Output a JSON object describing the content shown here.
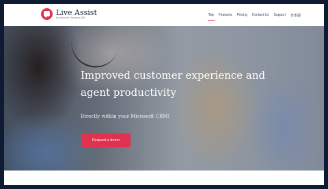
{
  "brand": {
    "name": "Live Assist",
    "tagline": "for Microsoft Dynamics 365",
    "accent_color": "#e0314f",
    "logo_icon": "chat-bubble-icon"
  },
  "nav": {
    "items": [
      {
        "label": "Top",
        "active": true
      },
      {
        "label": "Features",
        "active": false
      },
      {
        "label": "Pricing",
        "active": false
      },
      {
        "label": "Contact Us",
        "active": false
      },
      {
        "label": "Support",
        "active": false
      },
      {
        "label": "日本語",
        "active": false
      }
    ]
  },
  "hero": {
    "title_line1": "Improved customer experience and",
    "title_line2": "agent productivity",
    "subtitle": "Directly within your Microsoft CRM!",
    "cta_label": "Request a demo"
  }
}
